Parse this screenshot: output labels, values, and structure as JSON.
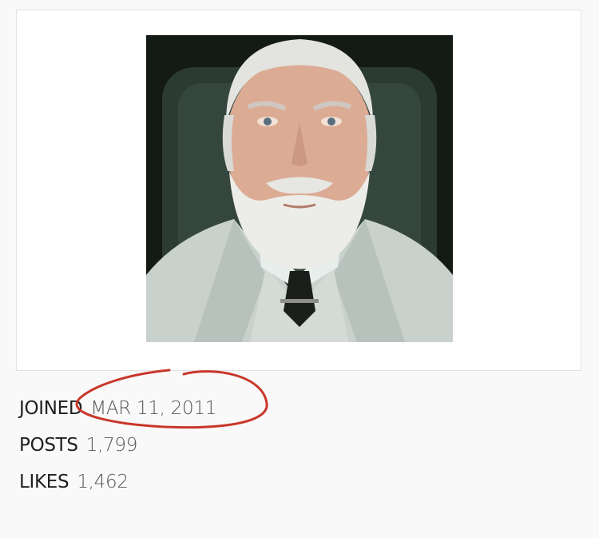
{
  "profile": {
    "stats": [
      {
        "label": "JOINED",
        "value": "MAR 11, 2011"
      },
      {
        "label": "POSTS",
        "value": "1,799"
      },
      {
        "label": "LIKES",
        "value": "1,462"
      }
    ]
  },
  "colors": {
    "background": "#f9f9f9",
    "card": "#ffffff",
    "label": "#1f1f1f",
    "value": "#555555",
    "annotation": "#c8372a"
  },
  "annotation": {
    "type": "hand-drawn-circle",
    "target": "joined-date"
  }
}
